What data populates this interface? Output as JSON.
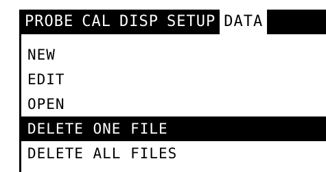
{
  "menubar": {
    "tabs": [
      {
        "label": "PROBE",
        "active": false
      },
      {
        "label": "CAL",
        "active": false
      },
      {
        "label": "DISP",
        "active": false
      },
      {
        "label": "SETUP",
        "active": false
      },
      {
        "label": "DATA",
        "active": true
      }
    ]
  },
  "data_menu": {
    "items": [
      {
        "label": "NEW",
        "selected": false
      },
      {
        "label": "EDIT",
        "selected": false
      },
      {
        "label": "OPEN",
        "selected": false
      },
      {
        "label": "DELETE ONE FILE",
        "selected": true
      },
      {
        "label": "DELETE ALL FILES",
        "selected": false
      }
    ]
  },
  "colors": {
    "foreground": "#000000",
    "background": "#ffffff"
  }
}
